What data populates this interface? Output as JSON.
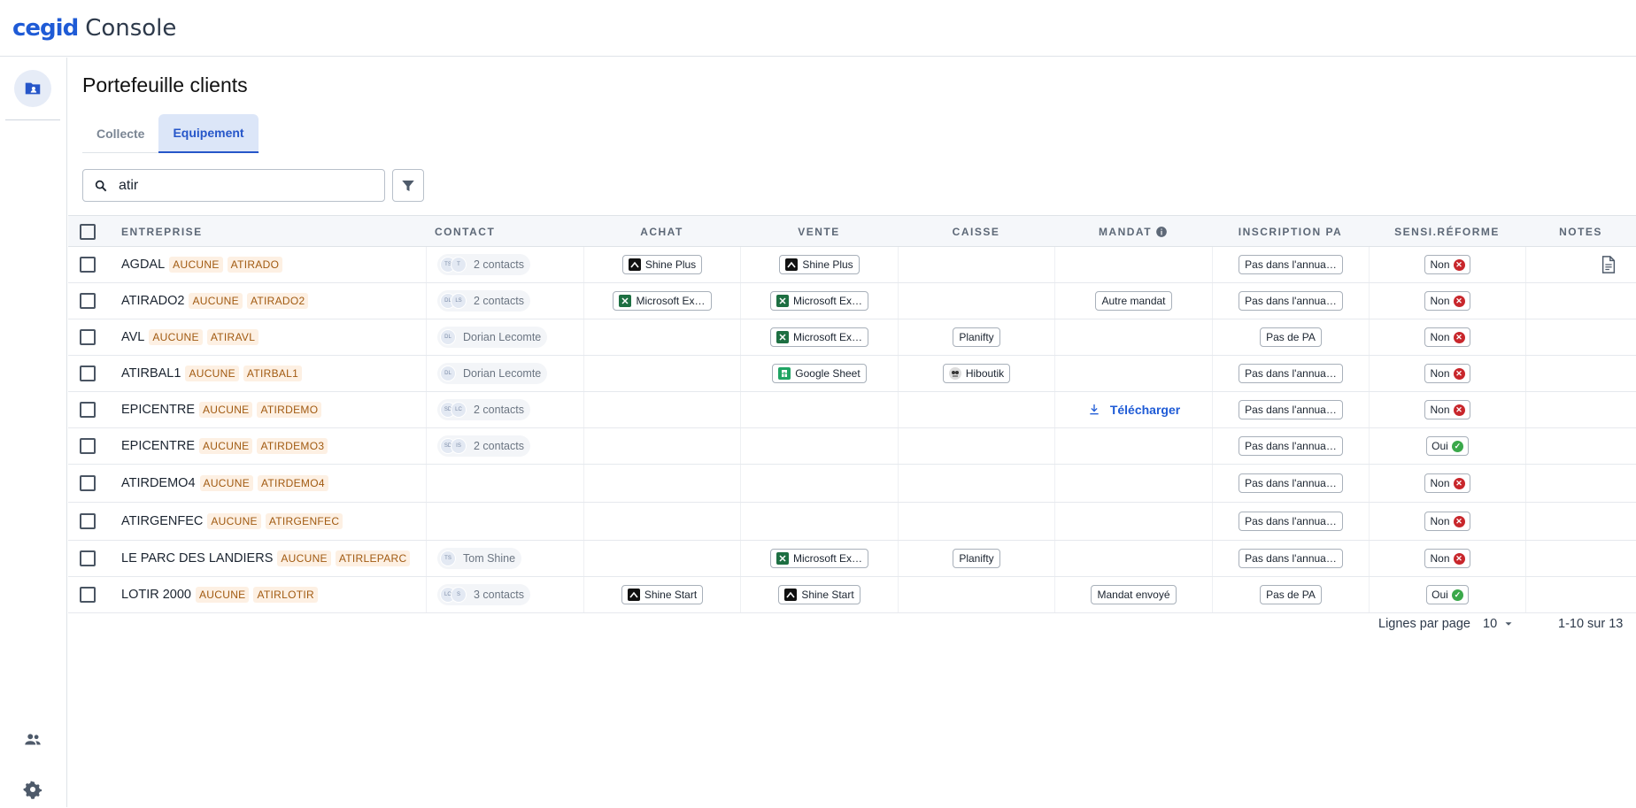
{
  "app": {
    "brand": "cegid",
    "name": "Console"
  },
  "page": {
    "title": "Portefeuille clients"
  },
  "tabs": [
    {
      "label": "Collecte",
      "active": false
    },
    {
      "label": "Equipement",
      "active": true
    }
  ],
  "search": {
    "value": "atir"
  },
  "columns": {
    "entreprise": "ENTREPRISE",
    "contact": "CONTACT",
    "achat": "ACHAT",
    "vente": "VENTE",
    "caisse": "CAISSE",
    "mandat": "MANDAT",
    "inscription": "INSCRIPTION PA",
    "sensi": "SENSI.RÉFORME",
    "notes": "NOTES"
  },
  "rows": [
    {
      "name": "AGDAL",
      "tags": [
        "AUCUNE",
        "ATIRADO"
      ],
      "avatars": [
        "TS",
        "T"
      ],
      "contact": "2 contacts",
      "achat": {
        "label": "Shine Plus",
        "icon": "shine"
      },
      "vente": {
        "label": "Shine Plus",
        "icon": "shine"
      },
      "caisse": null,
      "mandat": null,
      "inscription": "Pas dans l'annua…",
      "sensi": "Non",
      "sensi_ok": false,
      "note": true
    },
    {
      "name": "ATIRADO2",
      "tags": [
        "AUCUNE",
        "ATIRADO2"
      ],
      "avatars": [
        "DL",
        "LS"
      ],
      "contact": "2 contacts",
      "achat": {
        "label": "Microsoft Ex…",
        "icon": "excel"
      },
      "vente": {
        "label": "Microsoft Ex…",
        "icon": "excel"
      },
      "caisse": null,
      "mandat": {
        "label": "Autre mandat"
      },
      "inscription": "Pas dans l'annua…",
      "sensi": "Non",
      "sensi_ok": false,
      "note": false
    },
    {
      "name": "AVL",
      "tags": [
        "AUCUNE",
        "ATIRAVL"
      ],
      "avatars": [
        "DL"
      ],
      "contact": "Dorian Lecomte",
      "achat": null,
      "vente": {
        "label": "Microsoft Ex…",
        "icon": "excel"
      },
      "caisse": {
        "label": "Planifty",
        "icon": ""
      },
      "mandat": null,
      "inscription": "Pas de PA",
      "sensi": "Non",
      "sensi_ok": false,
      "note": false
    },
    {
      "name": "ATIRBAL1",
      "tags": [
        "AUCUNE",
        "ATIRBAL1"
      ],
      "avatars": [
        "DL"
      ],
      "contact": "Dorian Lecomte",
      "achat": null,
      "vente": {
        "label": "Google Sheet",
        "icon": "gsheet"
      },
      "caisse": {
        "label": "Hiboutik",
        "icon": "hibou"
      },
      "mandat": null,
      "inscription": "Pas dans l'annua…",
      "sensi": "Non",
      "sensi_ok": false,
      "note": false
    },
    {
      "name": "EPICENTRE",
      "tags": [
        "AUCUNE",
        "ATIRDEMO"
      ],
      "avatars": [
        "SD",
        "LC"
      ],
      "contact": "2 contacts",
      "achat": null,
      "vente": null,
      "caisse": null,
      "mandat": {
        "download": "Télécharger"
      },
      "inscription": "Pas dans l'annua…",
      "sensi": "Non",
      "sensi_ok": false,
      "note": false
    },
    {
      "name": "EPICENTRE",
      "tags": [
        "AUCUNE",
        "ATIRDEMO3"
      ],
      "avatars": [
        "SD",
        "IS"
      ],
      "contact": "2 contacts",
      "achat": null,
      "vente": null,
      "caisse": null,
      "mandat": null,
      "inscription": "Pas dans l'annua…",
      "sensi": "Oui",
      "sensi_ok": true,
      "note": false
    },
    {
      "name": "ATIRDEMO4",
      "tags": [
        "AUCUNE",
        "ATIRDEMO4"
      ],
      "avatars": [],
      "contact": "",
      "achat": null,
      "vente": null,
      "caisse": null,
      "mandat": null,
      "inscription": "Pas dans l'annua…",
      "sensi": "Non",
      "sensi_ok": false,
      "note": false
    },
    {
      "name": "ATIRGENFEC",
      "tags": [
        "AUCUNE",
        "ATIRGENFEC"
      ],
      "avatars": [],
      "contact": "",
      "achat": null,
      "vente": null,
      "caisse": null,
      "mandat": null,
      "inscription": "Pas dans l'annua…",
      "sensi": "Non",
      "sensi_ok": false,
      "note": false
    },
    {
      "name": "LE PARC DES LANDIERS",
      "tags": [
        "AUCUNE",
        "ATIRLEPARC"
      ],
      "avatars": [
        "TS"
      ],
      "contact": "Tom Shine",
      "achat": null,
      "vente": {
        "label": "Microsoft Ex…",
        "icon": "excel"
      },
      "caisse": {
        "label": "Planifty",
        "icon": ""
      },
      "mandat": null,
      "inscription": "Pas dans l'annua…",
      "sensi": "Non",
      "sensi_ok": false,
      "note": false
    },
    {
      "name": "LOTIR 2000",
      "tags": [
        "AUCUNE",
        "ATIRLOTIR"
      ],
      "avatars": [
        "LO",
        "S"
      ],
      "contact": "3 contacts",
      "achat": {
        "label": "Shine Start",
        "icon": "shine"
      },
      "vente": {
        "label": "Shine Start",
        "icon": "shine"
      },
      "caisse": null,
      "mandat": {
        "label": "Mandat envoyé"
      },
      "inscription": "Pas de PA",
      "sensi": "Oui",
      "sensi_ok": true,
      "note": false
    }
  ],
  "footer": {
    "rows_per_page_label": "Lignes par page",
    "rows_per_page": "10",
    "range": "1-10 sur 13"
  },
  "colors": {
    "brand": "#1f5bd6",
    "tag_text": "#a15a11",
    "tag_bg": "#fdf0e3",
    "no": "#c8262b",
    "yes": "#3aa84a"
  }
}
